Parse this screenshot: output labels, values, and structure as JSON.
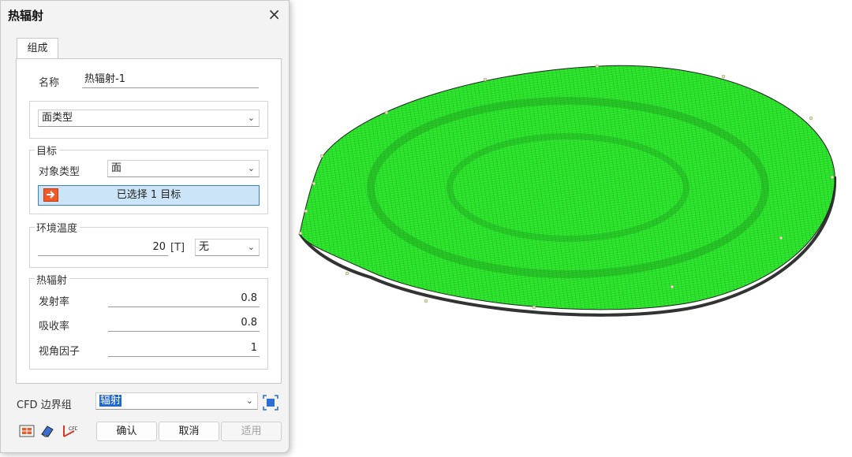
{
  "dialog": {
    "title": "热辐射",
    "close_icon": "×",
    "tab_label": "组成",
    "name_label": "名称",
    "name_value": "热辐射-1",
    "face_type_value": "面类型",
    "target": {
      "legend": "目标",
      "object_type_label": "对象类型",
      "object_type_value": "面",
      "select_button_label": "已选择 1 目标"
    },
    "ambient": {
      "legend": "环境温度",
      "value": "20",
      "unit": "[T]",
      "unit_select_value": "无"
    },
    "radiation": {
      "legend": "热辐射",
      "emissivity_label": "发射率",
      "emissivity_value": "0.8",
      "absorptivity_label": "吸收率",
      "absorptivity_value": "0.8",
      "view_factor_label": "视角因子",
      "view_factor_value": "1"
    },
    "cfd_group_label": "CFD 边界组",
    "cfd_group_value": "辐射",
    "ok_label": "确认",
    "cancel_label": "取消",
    "apply_label": "适用",
    "icons": [
      "arrow-select-icon",
      "table-icon",
      "eraser-icon",
      "cfd-icon",
      "zoom-fit-icon"
    ]
  },
  "viewport": {
    "model": "green meshed ellipse",
    "colors": {
      "mesh_fill": "#2ee82e",
      "mesh_line": "#1a8a1a",
      "edge": "#333333"
    }
  }
}
